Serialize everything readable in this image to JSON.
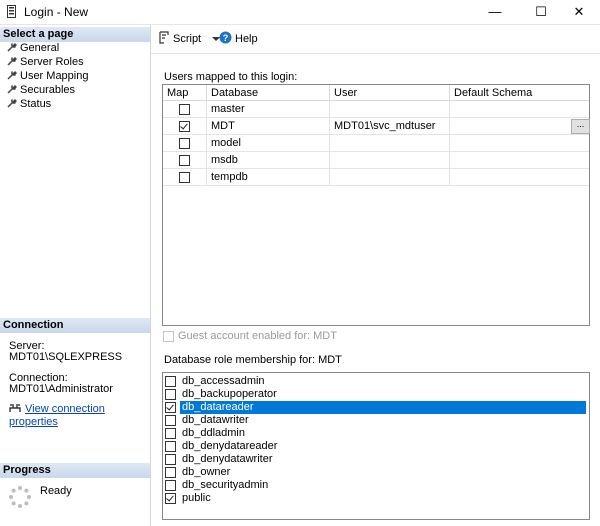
{
  "window": {
    "title": "Login - New",
    "minimize": "—",
    "maximize": "☐",
    "close": "✕"
  },
  "left_pane": {
    "select_page_header": "Select a page",
    "pages": [
      "General",
      "Server Roles",
      "User Mapping",
      "Securables",
      "Status"
    ],
    "connection_header": "Connection",
    "server_label": "Server:",
    "server_value": "MDT01\\SQLEXPRESS",
    "connection_label": "Connection:",
    "connection_value": "MDT01\\Administrator",
    "view_connection_link": "View connection properties",
    "progress_header": "Progress",
    "progress_status": "Ready"
  },
  "toolbar": {
    "script_label": "Script",
    "help_label": "Help"
  },
  "users_mapped": {
    "label": "Users mapped to this login:",
    "columns": [
      "Map",
      "Database",
      "User",
      "Default Schema"
    ],
    "rows": [
      {
        "map": false,
        "database": "master",
        "user": "",
        "schema": ""
      },
      {
        "map": true,
        "database": "MDT",
        "user": "MDT01\\svc_mdtuser",
        "schema": ""
      },
      {
        "map": false,
        "database": "model",
        "user": "",
        "schema": ""
      },
      {
        "map": false,
        "database": "msdb",
        "user": "",
        "schema": ""
      },
      {
        "map": false,
        "database": "tempdb",
        "user": "",
        "schema": ""
      }
    ],
    "ellipsis": "..."
  },
  "guest_account": "Guest account enabled for: MDT",
  "role_membership": {
    "label": "Database role membership for: MDT",
    "roles": [
      {
        "name": "db_accessadmin",
        "checked": false,
        "selected": false
      },
      {
        "name": "db_backupoperator",
        "checked": false,
        "selected": false
      },
      {
        "name": "db_datareader",
        "checked": true,
        "selected": true
      },
      {
        "name": "db_datawriter",
        "checked": false,
        "selected": false
      },
      {
        "name": "db_ddladmin",
        "checked": false,
        "selected": false
      },
      {
        "name": "db_denydatareader",
        "checked": false,
        "selected": false
      },
      {
        "name": "db_denydatawriter",
        "checked": false,
        "selected": false
      },
      {
        "name": "db_owner",
        "checked": false,
        "selected": false
      },
      {
        "name": "db_securityadmin",
        "checked": false,
        "selected": false
      },
      {
        "name": "public",
        "checked": true,
        "selected": false
      }
    ]
  },
  "colors": {
    "selection": "#0078d7",
    "link": "#0645ad",
    "section_header": "#c8d7ea"
  }
}
